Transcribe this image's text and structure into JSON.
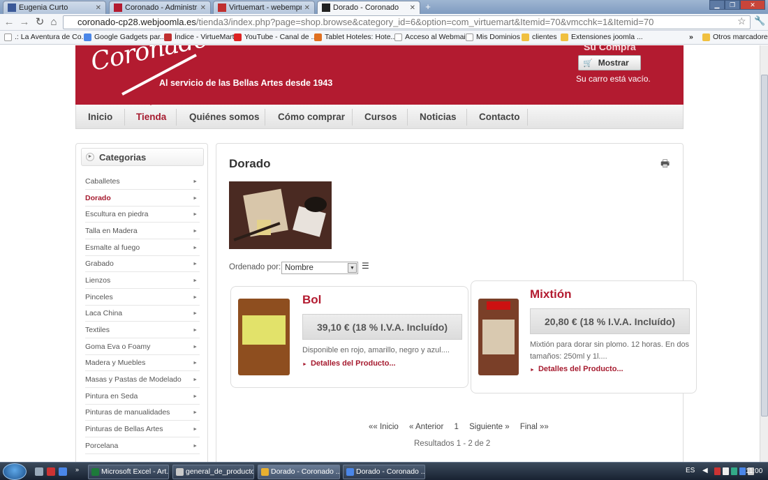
{
  "browser": {
    "tabs": [
      {
        "label": "Eugenia Curto",
        "favicon_color": "#3b5998"
      },
      {
        "label": "Coronado - Administraci...",
        "favicon_color": "#b31b30"
      },
      {
        "label": "Virtuemart - webempresa...",
        "favicon_color": "#c03030"
      },
      {
        "label": "Dorado - Coronado",
        "favicon_color": "#222222"
      }
    ],
    "new_tab_symbol": "+",
    "url_host": "coronado-cp28.webjoomla.es",
    "url_path": "/tienda3/index.php?page=shop.browse&category_id=6&option=com_virtuemart&Itemid=70&vmcchk=1&Itemid=70",
    "bookmarks": [
      {
        "label": ".: La Aventura de Co...",
        "icon_color": "#888888"
      },
      {
        "label": "Google Gadgets par...",
        "icon_color": "#4a86e8"
      },
      {
        "label": "Índice - VirtueMart",
        "icon_color": "#c03030"
      },
      {
        "label": "YouTube - Canal de ...",
        "icon_color": "#d22"
      },
      {
        "label": "Tablet Hoteles: Hote...",
        "icon_color": "#e07020"
      },
      {
        "label": "Acceso al Webmail",
        "icon_color": "#ffffff"
      },
      {
        "label": "Mis Dominios",
        "icon_color": "#ffffff"
      },
      {
        "label": "clientes",
        "icon_color": "#f0c040"
      },
      {
        "label": "Extensiones joomla ...",
        "icon_color": "#f0c040"
      }
    ],
    "bookmarks_overflow": "»",
    "other_bookmarks": "Otros marcadores"
  },
  "site": {
    "logo_text": "Coronado",
    "tagline": "Al servicio de las Bellas Artes desde 1943",
    "cart": {
      "title": "Su Compra",
      "button_label": "Mostrar",
      "status": "Su carro está vacío."
    },
    "nav": [
      "Inicio",
      "Tienda",
      "Quiénes somos",
      "Cómo comprar",
      "Cursos",
      "Noticias",
      "Contacto"
    ],
    "nav_active": "Tienda",
    "sidebar": {
      "title": "Categorias",
      "categories": [
        "Caballetes",
        "Dorado",
        "Escultura en piedra",
        "Talla en Madera",
        "Esmalte al fuego",
        "Grabado",
        "Lienzos",
        "Pinceles",
        "Laca China",
        "Textiles",
        "Goma Eva o Foamy",
        "Madera y Muebles",
        "Masas y Pastas de Modelado",
        "Pintura en Seda",
        "Pinturas de manualidades",
        "Pinturas de Bellas Artes",
        "Porcelana"
      ],
      "active_category": "Dorado"
    },
    "content": {
      "title": "Dorado",
      "sort_label": "Ordenado por:",
      "sort_value": "Nombre",
      "products": [
        {
          "name": "Bol",
          "price": "39,10 € (18 % I.V.A. Incluído)",
          "description": "Disponible en rojo, amarillo, negro y azul....",
          "link": "Detalles del Producto..."
        },
        {
          "name": "Mixtión",
          "price": "20,80 € (18 % I.V.A. Incluído)",
          "description": "Mixtión para dorar sin plomo. 12 horas. En dos tamaños: 250ml y 1l....",
          "link": "Detalles del Producto..."
        }
      ],
      "pagination": [
        "«« Inicio",
        "« Anterior",
        "1",
        "Siguiente »",
        "Final »»"
      ],
      "results": "Resultados 1 - 2 de 2"
    }
  },
  "taskbar": {
    "items": [
      {
        "label": "Microsoft Excel - Art...",
        "icon_color": "#1d7a3a"
      },
      {
        "label": "general_de_productos",
        "icon_color": "#c9c9c9"
      },
      {
        "label": "Dorado - Coronado ...",
        "icon_color": "#e8b030"
      },
      {
        "label": "Dorado - Coronado ...",
        "icon_color": "#4a86e8"
      }
    ],
    "language": "ES",
    "clock": "11:00"
  }
}
